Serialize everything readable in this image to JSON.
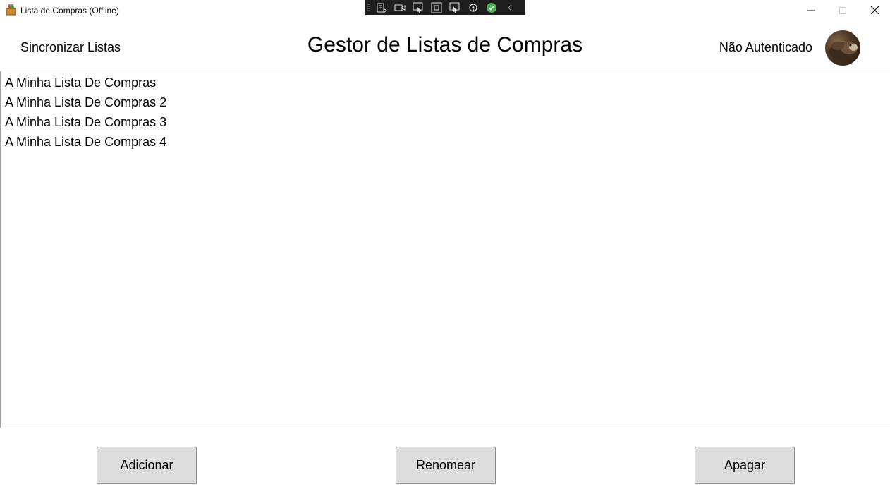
{
  "window": {
    "title": "Lista de Compras (Offline)",
    "icon": "shopping-basket-icon"
  },
  "header": {
    "sync_label": "Sincronizar Listas",
    "title": "Gestor de Listas de Compras",
    "auth_status": "Não Autenticado"
  },
  "lists": [
    {
      "name": "A Minha Lista De Compras"
    },
    {
      "name": "A Minha Lista De Compras 2"
    },
    {
      "name": "A Minha Lista De Compras 3"
    },
    {
      "name": "A Minha Lista De Compras 4"
    }
  ],
  "buttons": {
    "add": "Adicionar",
    "rename": "Renomear",
    "delete": "Apagar"
  },
  "colors": {
    "button_bg": "#dddddd",
    "button_border": "#8e8e8e",
    "toolbar_bg": "#1e1e1e",
    "check_green": "#4caf50"
  }
}
